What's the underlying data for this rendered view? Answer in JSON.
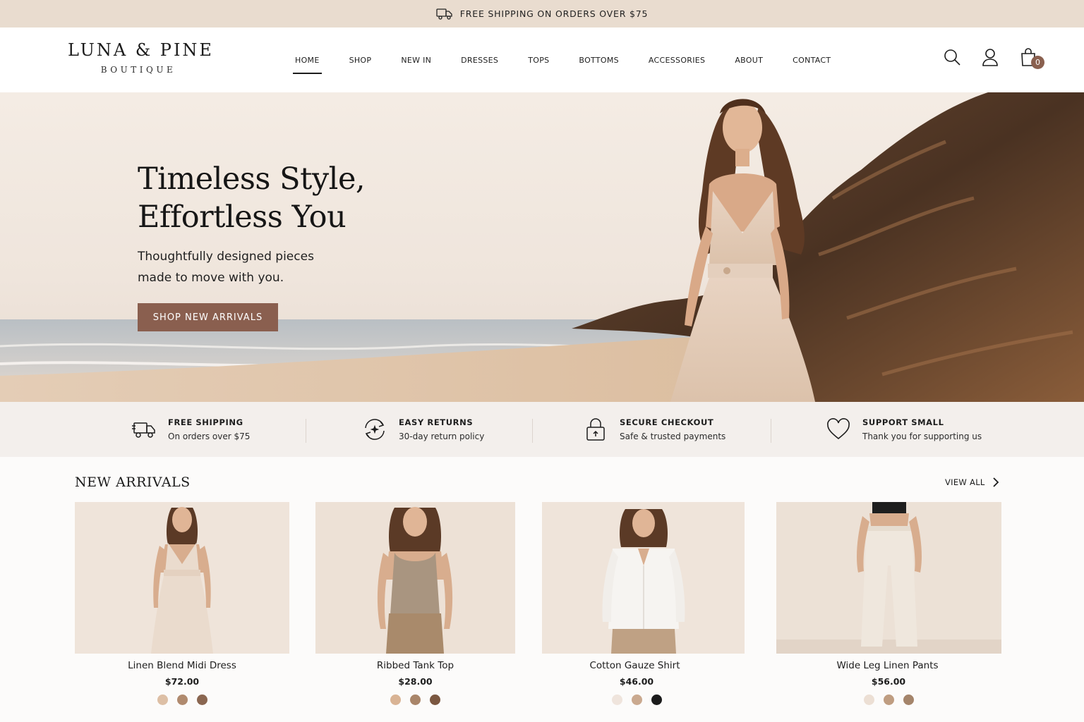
{
  "announcement": {
    "text": "FREE SHIPPING ON ORDERS OVER $75",
    "icon": "truck-icon"
  },
  "brand": {
    "name": "LUNA & PINE",
    "tagline": "BOUTIQUE"
  },
  "nav": {
    "items": [
      {
        "label": "HOME",
        "active": true
      },
      {
        "label": "SHOP"
      },
      {
        "label": "NEW IN"
      },
      {
        "label": "DRESSES"
      },
      {
        "label": "TOPS"
      },
      {
        "label": "BOTTOMS"
      },
      {
        "label": "ACCESSORIES"
      },
      {
        "label": "ABOUT"
      },
      {
        "label": "CONTACT"
      }
    ]
  },
  "header_icons": {
    "search": "search-icon",
    "account": "user-icon",
    "cart": "shopping-bag-icon",
    "cart_count": "0"
  },
  "hero": {
    "title_line1": "Timeless Style,",
    "title_line2": "Effortless You",
    "subtitle_line1": "Thoughtfully designed pieces",
    "subtitle_line2": "made to move with you.",
    "cta": "SHOP NEW ARRIVALS"
  },
  "features": [
    {
      "icon": "truck-icon",
      "title": "FREE SHIPPING",
      "desc": "On orders over $75"
    },
    {
      "icon": "returns-icon",
      "title": "EASY RETURNS",
      "desc": "30-day return policy"
    },
    {
      "icon": "lock-icon",
      "title": "SECURE CHECKOUT",
      "desc": "Safe & trusted payments"
    },
    {
      "icon": "heart-icon",
      "title": "SUPPORT SMALL",
      "desc": "Thank you for supporting us"
    }
  ],
  "new_arrivals": {
    "title": "NEW ARRIVALS",
    "view_all": "VIEW ALL",
    "products": [
      {
        "name": "Linen Blend Midi Dress",
        "price": "$72.00",
        "swatches": [
          "#ddbfa5",
          "#b08a6e",
          "#8a6650"
        ]
      },
      {
        "name": "Ribbed Tank Top",
        "price": "$28.00",
        "swatches": [
          "#d9b394",
          "#a98569",
          "#7b5740"
        ]
      },
      {
        "name": "Cotton Gauze Shirt",
        "price": "$46.00",
        "swatches": [
          "#efe4dc",
          "#caa98f",
          "#1b1b1b"
        ]
      },
      {
        "name": "Wide Leg Linen Pants",
        "price": "$56.00",
        "swatches": [
          "#ecdfd4",
          "#bf9d81",
          "#a4846a"
        ]
      }
    ]
  },
  "colors": {
    "accent": "#8a5f4f",
    "announce_bg": "#e9dccf",
    "feature_bg": "#f3efec"
  }
}
